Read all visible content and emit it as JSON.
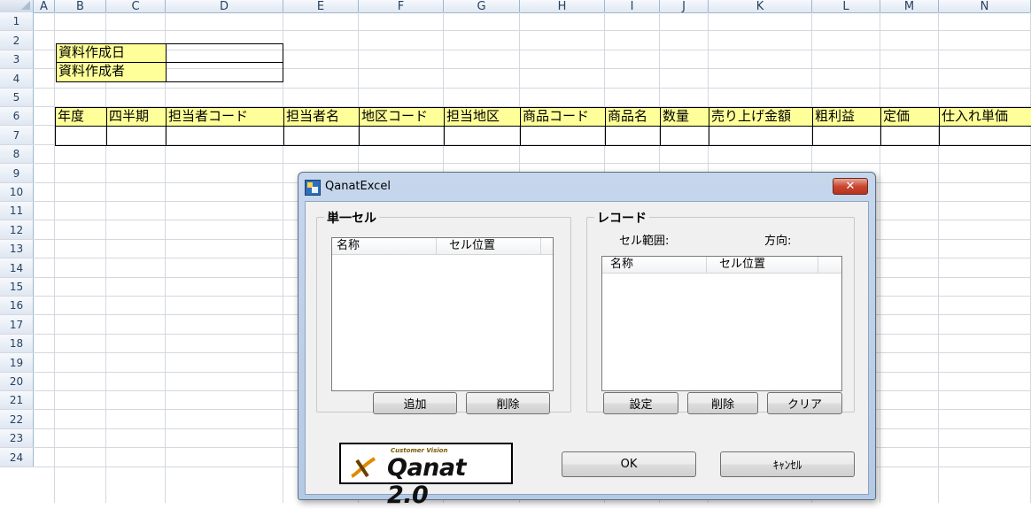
{
  "sheet": {
    "columns": [
      "A",
      "B",
      "C",
      "D",
      "E",
      "F",
      "G",
      "H",
      "I",
      "J",
      "K",
      "L",
      "M",
      "N"
    ],
    "rows": [
      "1",
      "2",
      "3",
      "4",
      "5",
      "6",
      "7",
      "8",
      "9",
      "10",
      "11",
      "12",
      "13",
      "14",
      "15",
      "16",
      "17",
      "18",
      "19",
      "20",
      "21",
      "22",
      "23",
      "24"
    ],
    "cells": {
      "doc_date_label": "資料作成日",
      "doc_author_label": "資料作成者",
      "headers": [
        "年度",
        "四半期",
        "担当者コード",
        "担当者名",
        "地区コード",
        "担当地区",
        "商品コード",
        "商品名",
        "数量",
        "売り上げ金額",
        "粗利益",
        "定価",
        "仕入れ単価"
      ]
    },
    "colors": {
      "header_fill": "#ffff99",
      "grid": "#d4d8de"
    }
  },
  "dialog": {
    "title": "QanatExcel",
    "close_label": "✕",
    "single_cell": {
      "group_label": "単一セル",
      "columns": [
        "名称",
        "セル位置"
      ],
      "add_label": "追加",
      "delete_label": "削除"
    },
    "record": {
      "group_label": "レコード",
      "range_label": "セル範囲:",
      "direction_label": "方向:",
      "columns": [
        "名称",
        "セル位置"
      ],
      "set_label": "設定",
      "delete_label": "削除",
      "clear_label": "クリア"
    },
    "logo": {
      "sub": "Customer Vision",
      "main": "Qanat 2.0"
    },
    "ok_label": "OK",
    "cancel_label": "ｷｬﾝｾﾙ"
  }
}
